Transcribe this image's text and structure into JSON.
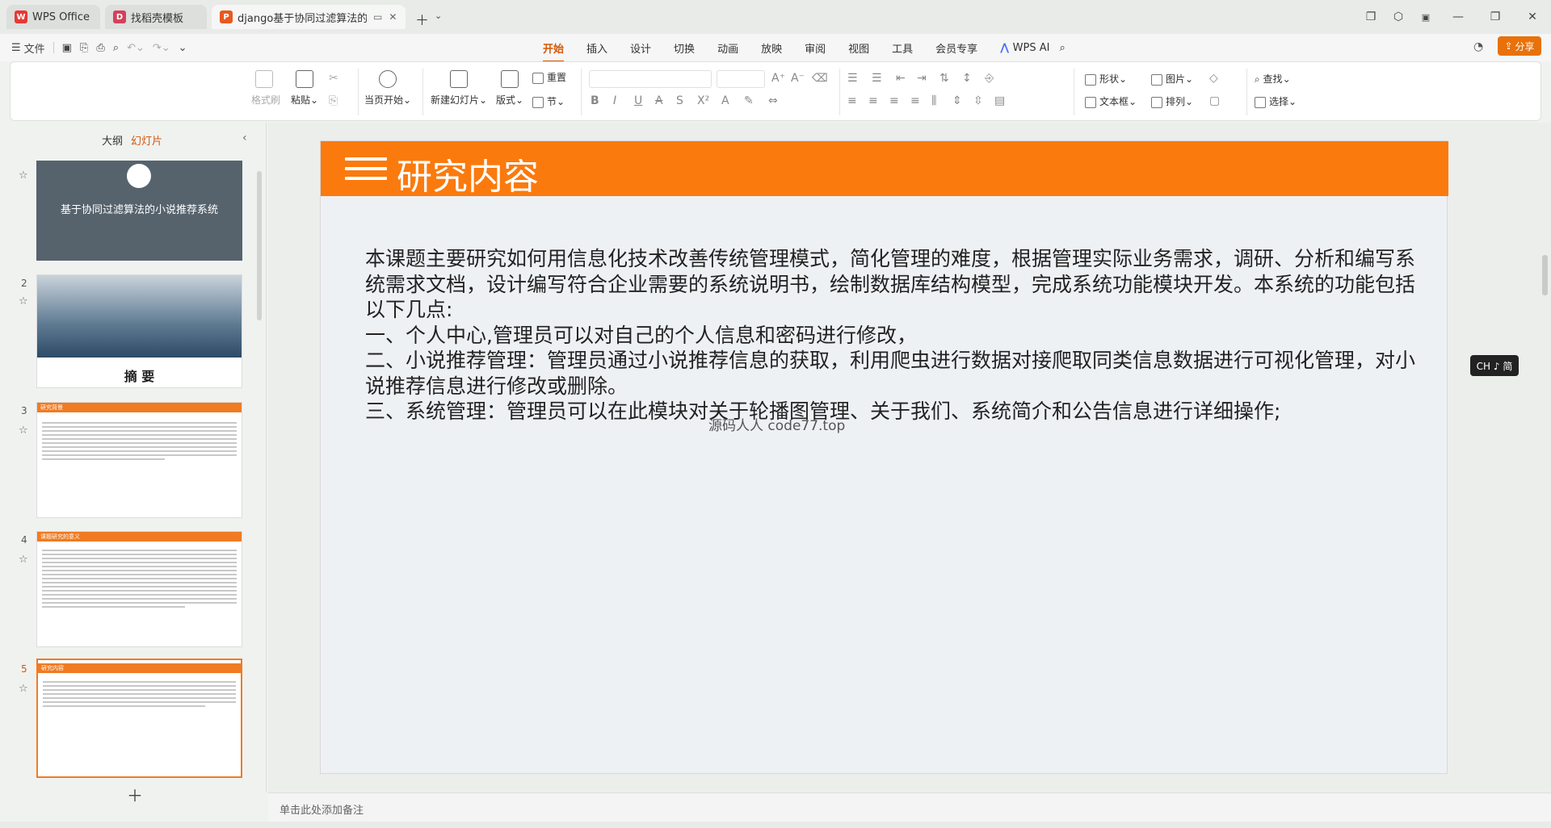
{
  "titlebar": {
    "tabs": [
      {
        "label": "WPS Office",
        "icon": "wps-logo-icon"
      },
      {
        "label": "找稻壳模板",
        "icon": "docer-icon"
      },
      {
        "label": "django基于协同过滤算法的小",
        "icon": "presentation-file-icon"
      }
    ]
  },
  "menubar": {
    "file_label": "文件",
    "tabs": [
      "开始",
      "插入",
      "设计",
      "切换",
      "动画",
      "放映",
      "审阅",
      "视图",
      "工具",
      "会员专享",
      "WPS AI"
    ],
    "active_tab": "开始",
    "share_label": "分享"
  },
  "ribbon": {
    "format_painter": "格式刷",
    "paste": "粘贴",
    "start_from_current": "当页开始",
    "new_slide": "新建幻灯片",
    "layout": "版式",
    "reset": "重置",
    "section": "节",
    "shape": "形状",
    "picture": "图片",
    "textbox": "文本框",
    "arrange": "排列",
    "find": "查找",
    "select": "选择"
  },
  "leftpanel": {
    "tab_outline": "大纲",
    "tab_slides": "幻灯片",
    "slides": [
      {
        "num": "",
        "title": "基于协同过滤算法的小说推荐系统"
      },
      {
        "num": "2",
        "title": "摘  要"
      },
      {
        "num": "3",
        "title": "研究背景"
      },
      {
        "num": "4",
        "title": "课题研究的意义"
      },
      {
        "num": "5",
        "title": "研究内容"
      }
    ]
  },
  "slide": {
    "title": "研究内容",
    "paragraphs": [
      "本课题主要研究如何用信息化技术改善传统管理模式，简化管理的难度，根据管理实际业务需求，调研、分析和编写系统需求文档，设计编写符合企业需要的系统说明书，绘制数据库结构模型，完成系统功能模块开发。本系统的功能包括以下几点:",
      "一、个人中心,管理员可以对自己的个人信息和密码进行修改，",
      "二、小说推荐管理：管理员通过小说推荐信息的获取，利用爬虫进行数据对接爬取同类信息数据进行可视化管理，对小说推荐信息进行修改或删除。",
      "三、系统管理：管理员可以在此模块对关于轮播图管理、关于我们、系统简介和公告信息进行详细操作;"
    ],
    "watermark": "源码人人 code77.top"
  },
  "ime": {
    "label": "CH ♪ 简"
  },
  "notes": {
    "placeholder": "单击此处添加备注"
  }
}
